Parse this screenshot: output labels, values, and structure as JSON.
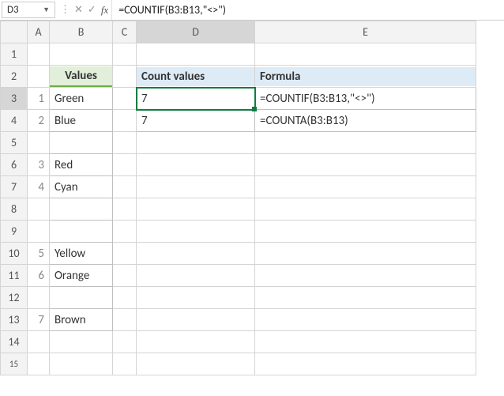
{
  "nameBox": {
    "ref": "D3"
  },
  "formulaBar": {
    "cancel": "✕",
    "confirm": "✓",
    "fx": "fx",
    "formula": "=COUNTIF(B3:B13,\"<>\")"
  },
  "columns": {
    "A": "A",
    "B": "B",
    "C": "C",
    "D": "D",
    "E": "E"
  },
  "rowLabels": [
    "1",
    "2",
    "3",
    "4",
    "5",
    "6",
    "7",
    "8",
    "9",
    "10",
    "11",
    "12",
    "13",
    "14",
    "15"
  ],
  "headers": {
    "values": "Values",
    "countValues": "Count values",
    "formula": "Formula"
  },
  "colA": {
    "r3": "1",
    "r4": "2",
    "r6": "3",
    "r7": "4",
    "r10": "5",
    "r11": "6",
    "r13": "7"
  },
  "colB": {
    "r3": "Green",
    "r4": "Blue",
    "r5": "",
    "r6": "Red",
    "r7": "Cyan",
    "r8": "",
    "r9": "",
    "r10": "Yellow",
    "r11": "Orange",
    "r12": "",
    "r13": "Brown"
  },
  "colD": {
    "r3": "7",
    "r4": "7"
  },
  "colE": {
    "r3": "=COUNTIF(B3:B13,\"<>\")",
    "r4": "=COUNTA(B3:B13)"
  }
}
